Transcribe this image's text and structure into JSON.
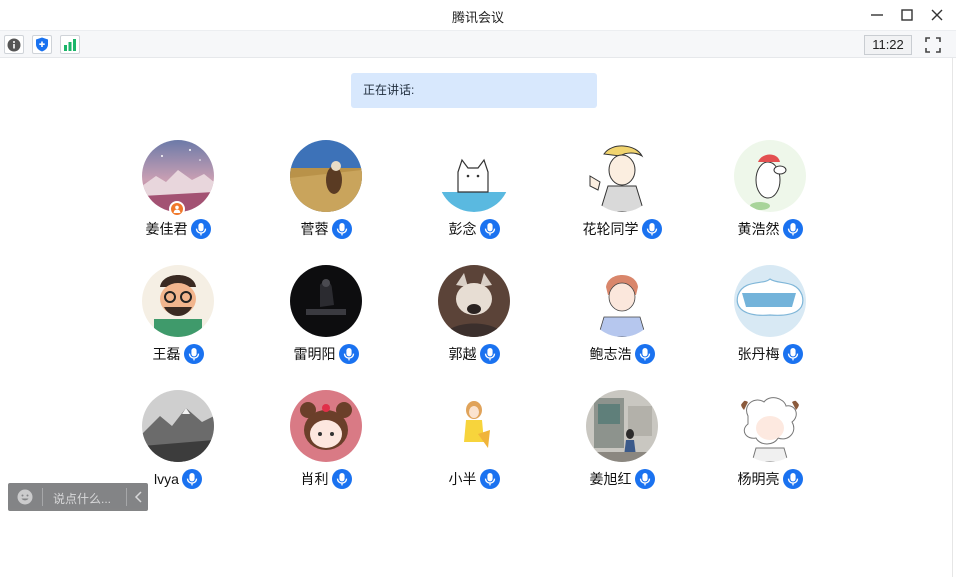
{
  "window": {
    "title": "腾讯会议"
  },
  "toolbar": {
    "clock": "11:22"
  },
  "speaking": {
    "label": "正在讲话:"
  },
  "chat": {
    "placeholder": "说点什么..."
  },
  "icons": {
    "info": "info-icon",
    "security": "shield-icon",
    "network": "signal-bars-icon",
    "fullscreen": "fullscreen-icon",
    "mic": "mic-icon",
    "host": "host-person-icon",
    "emoji": "emoji-face-icon",
    "collapse": "chevron-left-icon"
  },
  "colors": {
    "accent": "#1a72f0",
    "host": "#f0782a",
    "speaking_bg": "#d8e8fd"
  },
  "participants": [
    {
      "name": "姜佳君",
      "host": true
    },
    {
      "name": "菅蓉"
    },
    {
      "name": "彭念"
    },
    {
      "name": "花轮同学"
    },
    {
      "name": "黄浩然"
    },
    {
      "name": "王磊"
    },
    {
      "name": "雷明阳"
    },
    {
      "name": "郭越"
    },
    {
      "name": "鲍志浩"
    },
    {
      "name": "张丹梅"
    },
    {
      "name": "lvya"
    },
    {
      "name": "肖利"
    },
    {
      "name": "小半"
    },
    {
      "name": "姜旭红"
    },
    {
      "name": "杨明亮"
    }
  ]
}
